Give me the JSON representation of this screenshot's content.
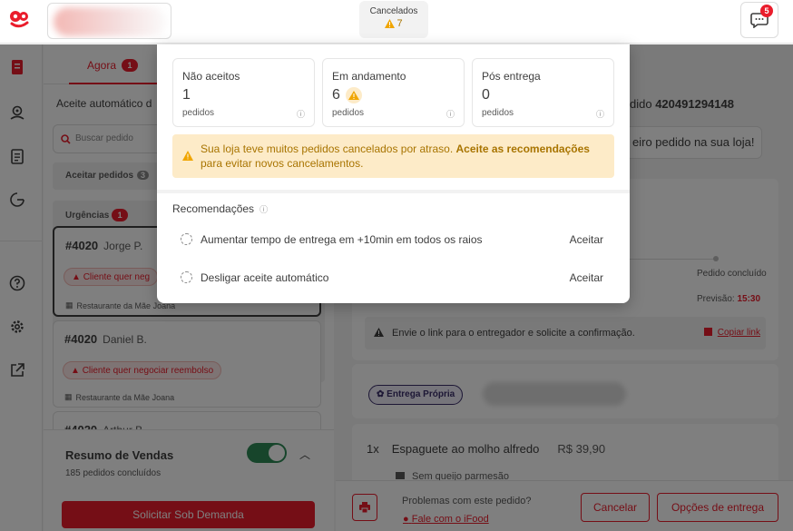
{
  "header": {
    "cancel_chip": {
      "label": "Cancelados",
      "count": "7"
    },
    "chat_badge": "5"
  },
  "left": {
    "tab_agora": "Agora",
    "tab_agora_badge": "1",
    "auto_accept_label": "Aceite automático d",
    "search_placeholder": "Buscar pedido",
    "section_accept": "Aceitar pedidos",
    "section_accept_badge": "3",
    "section_urgent": "Urgências",
    "section_urgent_badge": "1",
    "orders": [
      {
        "num": "#4020",
        "name": "Jorge P.",
        "alert": "Cliente quer neg",
        "restaurant": "Restaurante da Mãe Joana"
      },
      {
        "num": "#4020",
        "name": "Daniel B.",
        "alert": "Cliente quer negociar reembolso",
        "restaurant": "Restaurante da Mãe Joana"
      },
      {
        "num": "#4020",
        "name": "Arthur B."
      }
    ],
    "resumo": {
      "title": "Resumo de Vendas",
      "subtitle": "185 pedidos concluídos"
    },
    "demand_button": "Solicitar Sob Demanda"
  },
  "right": {
    "order_label": "dido",
    "order_number": "420491294148",
    "first_order": "eiro pedido na sua loja!",
    "timeline": {
      "fragment": "o",
      "final_step": "Pedido concluído",
      "forecast_label": "Previsão:",
      "forecast_time": "15:30"
    },
    "link_text": "Envie o link para o entregador e solicite a confirmação.",
    "copy_link": "Copiar link",
    "own_delivery": "Entrega Própria",
    "item": {
      "qty": "1x",
      "name": "Espaguete ao molho alfredo",
      "price": "R$ 39,90",
      "note": "Sem queijo parmesão"
    },
    "problems": "Problemas com este pedido?",
    "talk": "Fale com o iFood",
    "cancel_button": "Cancelar",
    "delivery_options_button": "Opções de entrega"
  },
  "modal": {
    "stats": [
      {
        "label": "Não aceitos",
        "value": "1",
        "unit": "pedidos"
      },
      {
        "label": "Em andamento",
        "value": "6",
        "unit": "pedidos"
      },
      {
        "label": "Pós entrega",
        "value": "0",
        "unit": "pedidos"
      }
    ],
    "warning_text": "Sua loja teve muitos pedidos cancelados por atraso.",
    "warning_link": "Aceite as recomendações",
    "warning_text_end": "para evitar novos cancelamentos.",
    "reco_title": "Recomendações",
    "recommendations": [
      {
        "text": "Aumentar tempo de entrega em +10min em todos os raios",
        "action": "Aceitar"
      },
      {
        "text": "Desligar aceite automático",
        "action": "Aceitar"
      }
    ]
  },
  "colors": {
    "brand_red": "#ea1d2c",
    "warning_bg": "#fdebc8",
    "warning_text": "#a87400",
    "success_green": "#2e8b57"
  }
}
